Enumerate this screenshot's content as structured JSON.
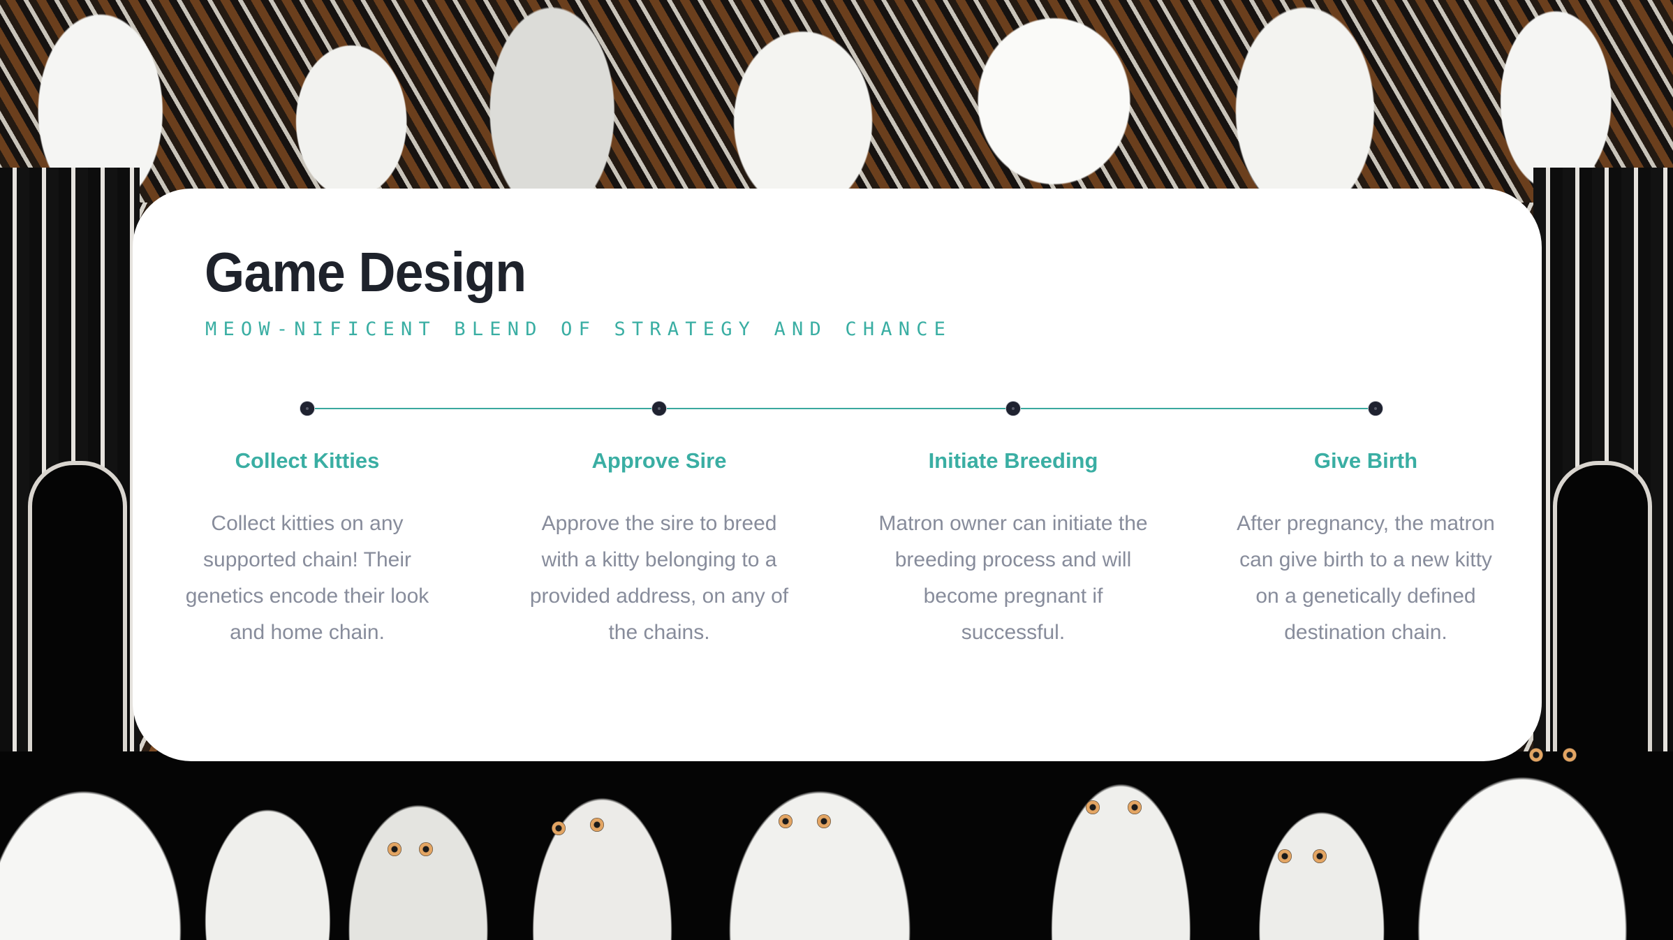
{
  "slide": {
    "title": "Game Design",
    "subtitle": "MEOW-NIFICENT BLEND OF STRATEGY AND CHANCE"
  },
  "timeline": {
    "steps": [
      {
        "title": "Collect Kitties",
        "description": "Collect kitties on any supported chain! Their genetics encode their look and home chain."
      },
      {
        "title": "Approve Sire",
        "description": "Approve the sire to breed with a kitty belonging to a provided address, on any of the chains."
      },
      {
        "title": "Initiate Breeding",
        "description": "Matron owner can initiate the breeding process and will become pregnant if successful."
      },
      {
        "title": "Give Birth",
        "description": "After pregnancy, the matron can give birth to a new kitty on a genetically defined destination chain."
      }
    ]
  },
  "colors": {
    "accent": "#3aaea3",
    "timeline_line": "#3aa89e",
    "dot": "#1f2230",
    "title": "#1e222b",
    "body_text": "#878c9b",
    "card": "#ffffff"
  },
  "background": {
    "description-icon": "illustrated-cats-background"
  }
}
